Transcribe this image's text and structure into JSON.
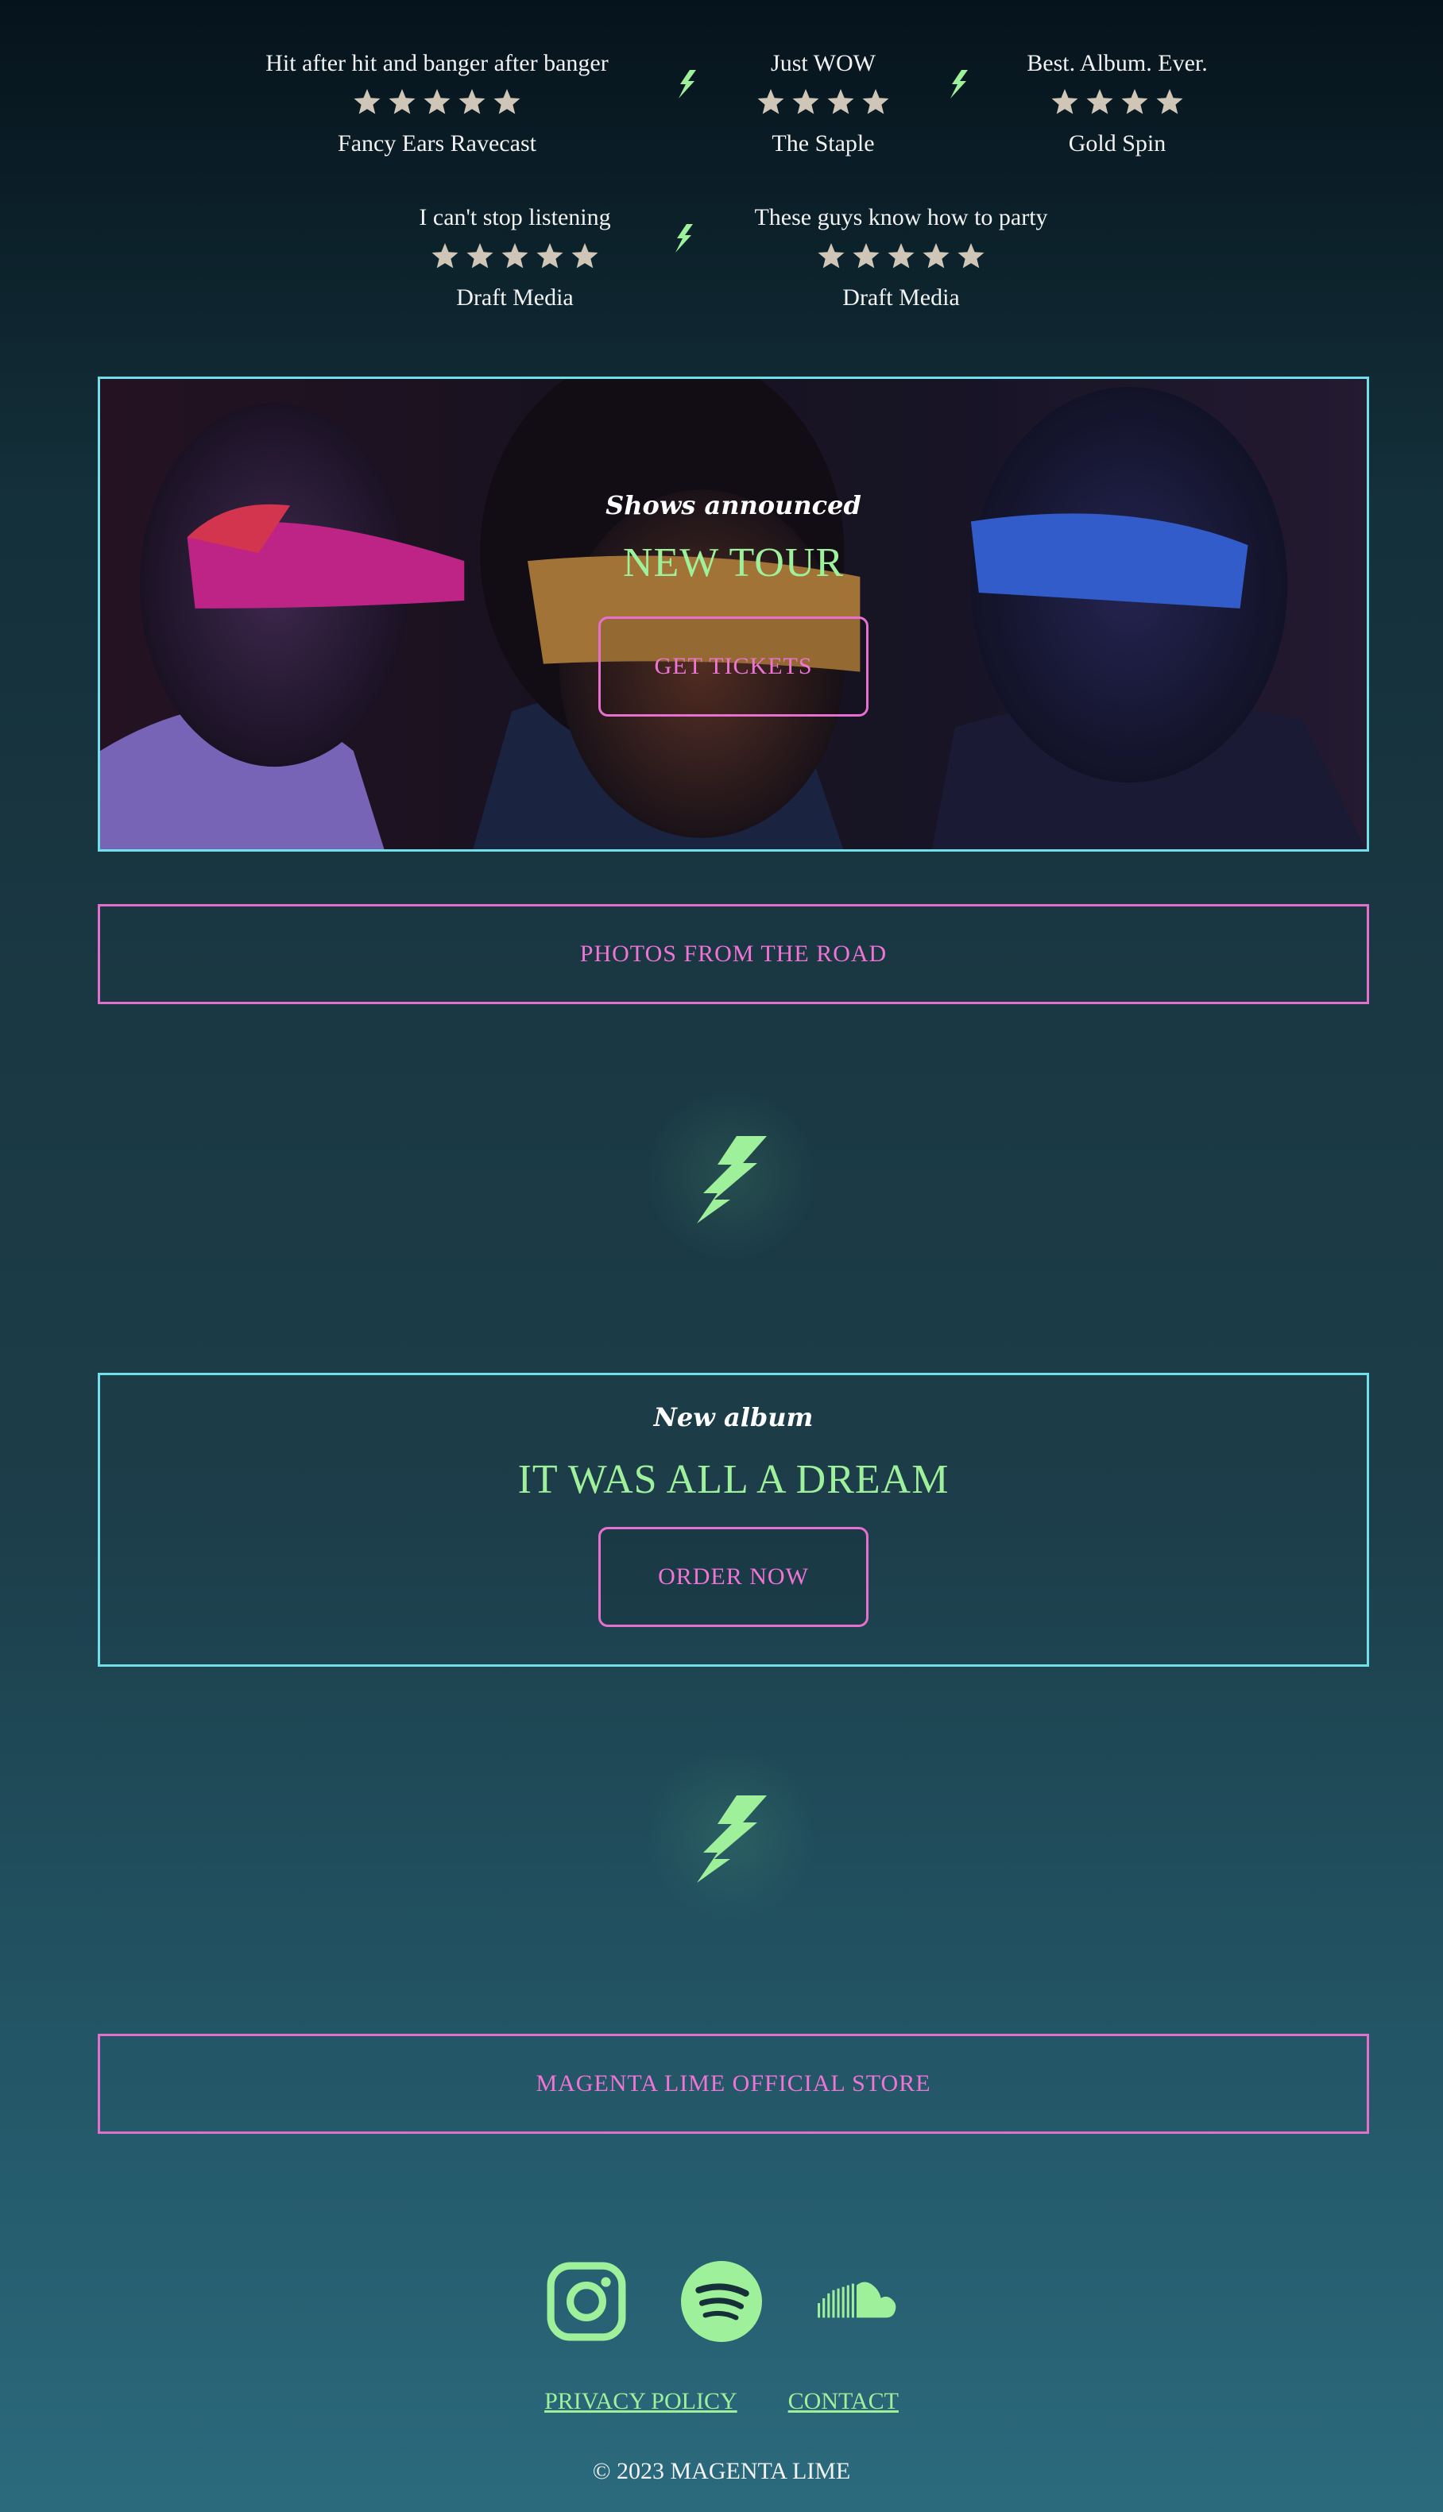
{
  "reviews": [
    {
      "quote": "Hit after hit and banger after banger",
      "rating": 5,
      "source": "Fancy Ears Ravecast"
    },
    {
      "quote": "Just WOW",
      "rating": 4,
      "source": "The Staple"
    },
    {
      "quote": "Best. Album. Ever.",
      "rating": 4,
      "source": "Gold Spin"
    },
    {
      "quote": "I can't stop listening",
      "rating": 5,
      "source": "Draft Media"
    },
    {
      "quote": "These guys know how to party",
      "rating": 5,
      "source": "Draft Media"
    }
  ],
  "tour": {
    "kicker": "Shows announced",
    "headline": "NEW TOUR",
    "cta_label": "GET TICKETS"
  },
  "photos_button": "PHOTOS FROM THE ROAD",
  "album": {
    "kicker": "New album",
    "headline": "IT WAS ALL A DREAM",
    "cta_label": "ORDER NOW"
  },
  "store_button": "MAGENTA LIME OFFICIAL STORE",
  "socials": [
    {
      "icon": "instagram-icon"
    },
    {
      "icon": "spotify-icon"
    },
    {
      "icon": "soundcloud-icon"
    }
  ],
  "footer": {
    "privacy": "PRIVACY POLICY",
    "contact": "CONTACT",
    "copyright": "© 2023 MAGENTA LIME"
  },
  "colors": {
    "accent_lime": "#9ef09b",
    "accent_magenta": "#ef74d6",
    "accent_cyan": "#71dfe9"
  }
}
